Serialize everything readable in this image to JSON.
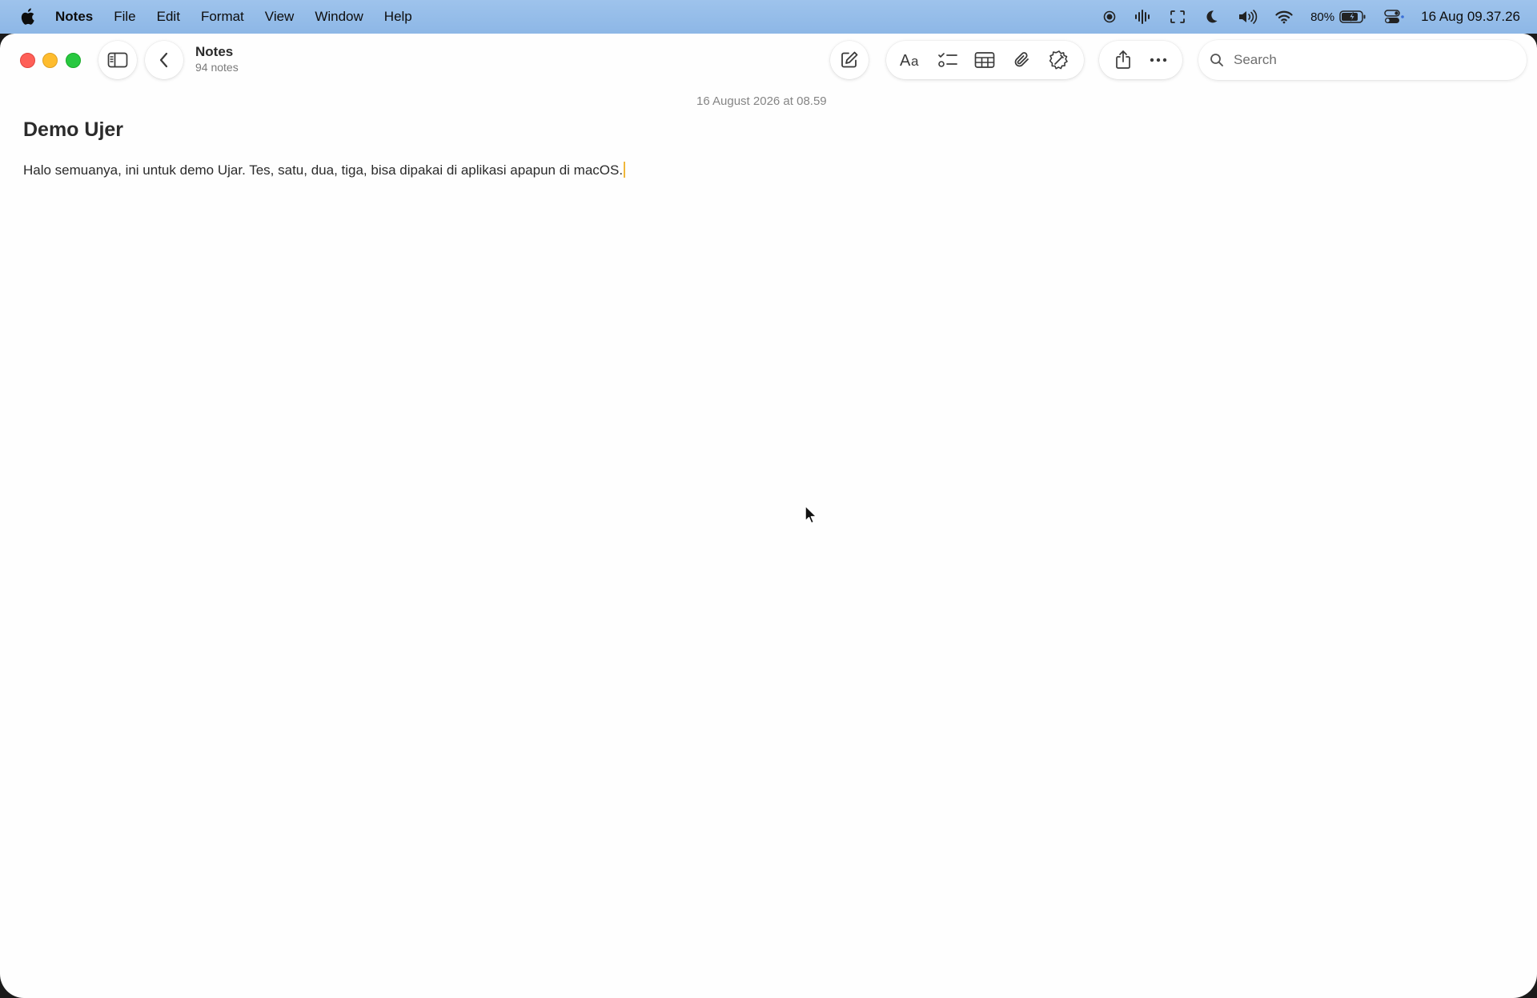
{
  "menubar": {
    "app_name": "Notes",
    "items": [
      "File",
      "Edit",
      "Format",
      "View",
      "Window",
      "Help"
    ],
    "battery_percent": "80%",
    "date": "16 Aug",
    "time": "09.37.26"
  },
  "toolbar": {
    "folder_name": "Notes",
    "note_count": "94 notes",
    "search_placeholder": "Search"
  },
  "note": {
    "date": "16 August 2026 at 08.59",
    "title": "Demo Ujer",
    "body": "Halo semuanya, ini untuk demo Ujar. Tes, satu, dua, tiga, bisa dipakai di aplikasi apapun di macOS."
  },
  "colors": {
    "menubar_bg": "#9ec3ec",
    "close": "#fe5f57",
    "minimize": "#febc2e",
    "maximize": "#28c840",
    "caret": "#f0b73a"
  },
  "icons": {
    "menubar_left": "apple-icon",
    "status": [
      "screen-record-icon",
      "waveform-icon",
      "screen-mirroring-icon",
      "moon-icon",
      "volume-icon",
      "wifi-icon",
      "battery-charging-icon",
      "control-center-icon"
    ],
    "toolbar": [
      "sidebar-toggle-icon",
      "chevron-left-icon",
      "compose-icon",
      "text-format-icon",
      "checklist-icon",
      "table-icon",
      "attachment-icon",
      "writing-tools-icon",
      "share-icon",
      "more-icon",
      "search-icon"
    ]
  }
}
